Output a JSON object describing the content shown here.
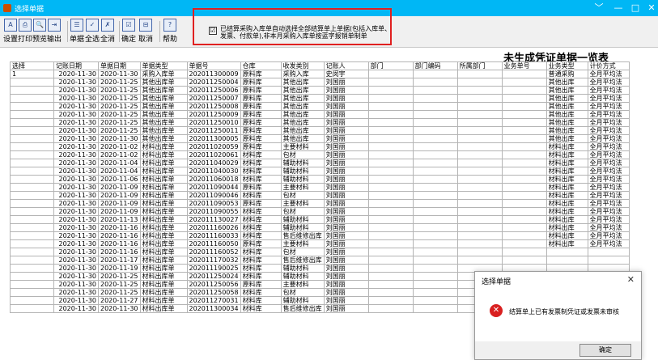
{
  "window": {
    "title": "选择单据",
    "min": "﹀",
    "restore": "—",
    "max": "□",
    "close": "✕"
  },
  "toolbar": {
    "buttons": [
      {
        "label": "设置",
        "icon": "A"
      },
      {
        "label": "打印",
        "icon": "⎙"
      },
      {
        "label": "预览",
        "icon": "🔍"
      },
      {
        "label": "输出",
        "icon": "⇥"
      },
      {
        "label": "单据",
        "icon": "☰"
      },
      {
        "label": "全选",
        "icon": "✓"
      },
      {
        "label": "全消",
        "icon": "✗"
      },
      {
        "label": "确定",
        "icon": "☑"
      },
      {
        "label": "取消",
        "icon": "⊟"
      },
      {
        "label": "帮助",
        "icon": "?"
      }
    ],
    "auto_select_checkbox": {
      "checked": true,
      "mark": "☑",
      "text": "已结算采购入库单自动选择全部结算单上单据(包括入库单、发票、付款单),非本月采购入库单按蓝字报销单制单"
    }
  },
  "report": {
    "title": "未生成凭证单据一览表"
  },
  "grid": {
    "headers": [
      "选择",
      "记账日期",
      "单据日期",
      "单据类型",
      "单据号",
      "仓库",
      "收发类别",
      "记账人",
      "部门",
      "部门编码",
      "所属部门",
      "业务单号",
      "业务类型",
      "计价方式"
    ],
    "rows": [
      [
        "1",
        "2020-11-30",
        "2020-11-30",
        "采购入库单",
        "202011300009",
        "原料库",
        "采购入库",
        "史闵宇",
        "",
        "",
        "",
        "",
        "普通采购",
        "全月平均法"
      ],
      [
        "",
        "2020-11-30",
        "2020-11-25",
        "其他出库单",
        "202011250004",
        "原料库",
        "其他出库",
        "刘国丽",
        "",
        "",
        "",
        "",
        "其他出库",
        "全月平均法"
      ],
      [
        "",
        "2020-11-30",
        "2020-11-25",
        "其他出库单",
        "202011250006",
        "原料库",
        "其他出库",
        "刘国丽",
        "",
        "",
        "",
        "",
        "其他出库",
        "全月平均法"
      ],
      [
        "",
        "2020-11-30",
        "2020-11-25",
        "其他出库单",
        "202011250007",
        "原料库",
        "其他出库",
        "刘国丽",
        "",
        "",
        "",
        "",
        "其他出库",
        "全月平均法"
      ],
      [
        "",
        "2020-11-30",
        "2020-11-25",
        "其他出库单",
        "202011250008",
        "原料库",
        "其他出库",
        "刘国丽",
        "",
        "",
        "",
        "",
        "其他出库",
        "全月平均法"
      ],
      [
        "",
        "2020-11-30",
        "2020-11-25",
        "其他出库单",
        "202011250009",
        "原料库",
        "其他出库",
        "刘国丽",
        "",
        "",
        "",
        "",
        "其他出库",
        "全月平均法"
      ],
      [
        "",
        "2020-11-30",
        "2020-11-25",
        "其他出库单",
        "202011250010",
        "原料库",
        "其他出库",
        "刘国丽",
        "",
        "",
        "",
        "",
        "其他出库",
        "全月平均法"
      ],
      [
        "",
        "2020-11-30",
        "2020-11-25",
        "其他出库单",
        "202011250011",
        "原料库",
        "其他出库",
        "刘国丽",
        "",
        "",
        "",
        "",
        "其他出库",
        "全月平均法"
      ],
      [
        "",
        "2020-11-30",
        "2020-11-30",
        "其他出库单",
        "202011300005",
        "原料库",
        "其他出库",
        "刘国丽",
        "",
        "",
        "",
        "",
        "其他出库",
        "全月平均法"
      ],
      [
        "",
        "2020-11-30",
        "2020-11-02",
        "材料出库单",
        "202011020059",
        "原料库",
        "主要材料",
        "刘国丽",
        "",
        "",
        "",
        "",
        "材料出库",
        "全月平均法"
      ],
      [
        "",
        "2020-11-30",
        "2020-11-02",
        "材料出库单",
        "202011020061",
        "材料库",
        "包材",
        "刘国丽",
        "",
        "",
        "",
        "",
        "材料出库",
        "全月平均法"
      ],
      [
        "",
        "2020-11-30",
        "2020-11-04",
        "材料出库单",
        "202011040029",
        "材料库",
        "辅助材料",
        "刘国丽",
        "",
        "",
        "",
        "",
        "材料出库",
        "全月平均法"
      ],
      [
        "",
        "2020-11-30",
        "2020-11-04",
        "材料出库单",
        "202011040030",
        "材料库",
        "辅助材料",
        "刘国丽",
        "",
        "",
        "",
        "",
        "材料出库",
        "全月平均法"
      ],
      [
        "",
        "2020-11-30",
        "2020-11-06",
        "材料出库单",
        "202011060018",
        "材料库",
        "辅助材料",
        "刘国丽",
        "",
        "",
        "",
        "",
        "材料出库",
        "全月平均法"
      ],
      [
        "",
        "2020-11-30",
        "2020-11-09",
        "材料出库单",
        "202011090044",
        "原料库",
        "主要材料",
        "刘国丽",
        "",
        "",
        "",
        "",
        "材料出库",
        "全月平均法"
      ],
      [
        "",
        "2020-11-30",
        "2020-11-09",
        "材料出库单",
        "202011090046",
        "材料库",
        "包材",
        "刘国丽",
        "",
        "",
        "",
        "",
        "材料出库",
        "全月平均法"
      ],
      [
        "",
        "2020-11-30",
        "2020-11-09",
        "材料出库单",
        "202011090053",
        "原料库",
        "主要材料",
        "刘国丽",
        "",
        "",
        "",
        "",
        "材料出库",
        "全月平均法"
      ],
      [
        "",
        "2020-11-30",
        "2020-11-09",
        "材料出库单",
        "202011090055",
        "材料库",
        "包材",
        "刘国丽",
        "",
        "",
        "",
        "",
        "材料出库",
        "全月平均法"
      ],
      [
        "",
        "2020-11-30",
        "2020-11-13",
        "材料出库单",
        "202011130027",
        "材料库",
        "辅助材料",
        "刘国丽",
        "",
        "",
        "",
        "",
        "材料出库",
        "全月平均法"
      ],
      [
        "",
        "2020-11-30",
        "2020-11-16",
        "材料出库单",
        "202011160026",
        "材料库",
        "辅助材料",
        "刘国丽",
        "",
        "",
        "",
        "",
        "材料出库",
        "全月平均法"
      ],
      [
        "",
        "2020-11-30",
        "2020-11-16",
        "材料出库单",
        "202011160033",
        "材料库",
        "售后维修出库",
        "刘国丽",
        "",
        "",
        "",
        "",
        "材料出库",
        "全月平均法"
      ],
      [
        "",
        "2020-11-30",
        "2020-11-16",
        "材料出库单",
        "202011160050",
        "原料库",
        "主要材料",
        "刘国丽",
        "",
        "",
        "",
        "",
        "材料出库",
        "全月平均法"
      ],
      [
        "",
        "2020-11-30",
        "2020-11-16",
        "材料出库单",
        "202011160052",
        "材料库",
        "包材",
        "刘国丽",
        "",
        "",
        "",
        "",
        "",
        ""
      ],
      [
        "",
        "2020-11-30",
        "2020-11-17",
        "材料出库单",
        "202011170032",
        "材料库",
        "售后维修出库",
        "刘国丽",
        "",
        "",
        "",
        "",
        "",
        ""
      ],
      [
        "",
        "2020-11-30",
        "2020-11-19",
        "材料出库单",
        "202011190025",
        "材料库",
        "辅助材料",
        "刘国丽",
        "",
        "",
        "",
        "",
        "",
        ""
      ],
      [
        "",
        "2020-11-30",
        "2020-11-25",
        "材料出库单",
        "202011250024",
        "材料库",
        "辅助材料",
        "刘国丽",
        "",
        "",
        "",
        "",
        "",
        ""
      ],
      [
        "",
        "2020-11-30",
        "2020-11-25",
        "材料出库单",
        "202011250056",
        "原料库",
        "主要材料",
        "刘国丽",
        "",
        "",
        "",
        "",
        "",
        ""
      ],
      [
        "",
        "2020-11-30",
        "2020-11-25",
        "材料出库单",
        "202011250058",
        "材料库",
        "包材",
        "刘国丽",
        "",
        "",
        "",
        "",
        "",
        ""
      ],
      [
        "",
        "2020-11-30",
        "2020-11-27",
        "材料出库单",
        "202011270031",
        "材料库",
        "辅助材料",
        "刘国丽",
        "",
        "",
        "",
        "",
        "",
        ""
      ],
      [
        "",
        "2020-11-30",
        "2020-11-30",
        "材料出库单",
        "202011300034",
        "材料库",
        "售后维修出库",
        "刘国丽",
        "",
        "",
        "",
        "",
        "",
        ""
      ]
    ]
  },
  "dialog": {
    "title": "选择单据",
    "close": "✕",
    "message": "结算单上已有发票制凭证或发票未审核",
    "ok_label": "确定",
    "icon": "✕"
  }
}
